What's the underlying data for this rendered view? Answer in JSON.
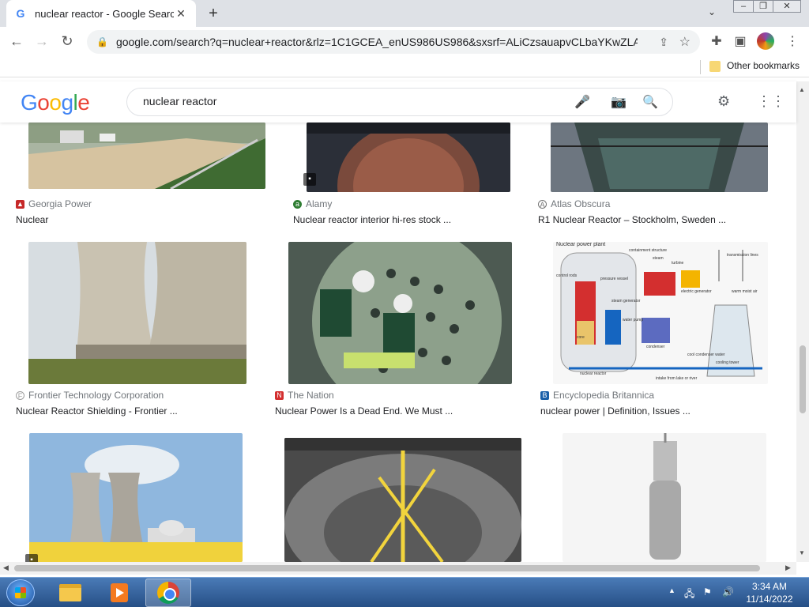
{
  "browser": {
    "tab_title": "nuclear reactor - Google Search",
    "favicon": "G",
    "url": "google.com/search?q=nuclear+reactor&rlz=1C1GCEA_enUS986US986&sxsrf=ALiCzsauapvCLbaYKwZLAJW...",
    "bookmark_folder": "Other bookmarks"
  },
  "search": {
    "query": "nuclear reactor"
  },
  "results": [
    {
      "source": "Georgia Power",
      "title": "Nuclear",
      "source_icon_color": "#c62828"
    },
    {
      "source": "Alamy",
      "title": "Nuclear reactor interior hi-res stock ...",
      "source_icon_color": "#2e7d32"
    },
    {
      "source": "Atlas Obscura",
      "title": "R1 Nuclear Reactor – Stockholm, Sweden ...",
      "source_icon_color": "#757575"
    },
    {
      "source": "Frontier Technology Corporation",
      "title": "Nuclear Reactor Shielding - Frontier ...",
      "source_icon_color": "#9e9e9e"
    },
    {
      "source": "The Nation",
      "title": "Nuclear Power Is a Dead End. We Must ...",
      "source_icon_color": "#d32f2f"
    },
    {
      "source": "Encyclopedia Britannica",
      "title": "nuclear power | Definition, Issues ...",
      "source_icon_color": "#1a5fa8"
    }
  ],
  "diagram": {
    "title": "Nuclear power plant",
    "labels": [
      "containment structure",
      "steam",
      "turbine",
      "electric generator",
      "transmission lines",
      "control rods",
      "pressure vessel",
      "steam generator",
      "condenser",
      "warm moist air",
      "water pump",
      "cooling tower",
      "core",
      "nuclear reactor",
      "cool condenser water",
      "intake from lake or river"
    ]
  },
  "taskbar": {
    "time": "3:34 AM",
    "date": "11/14/2022"
  },
  "colors": {
    "accent_blue": "#1a73e8",
    "taskbar": "#264f86"
  }
}
